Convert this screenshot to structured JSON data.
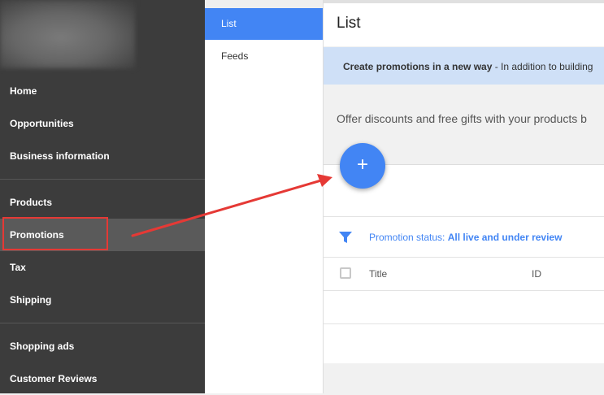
{
  "left_nav": {
    "items": [
      {
        "label": "Home"
      },
      {
        "label": "Opportunities"
      },
      {
        "label": "Business information"
      },
      {
        "label": "Products"
      },
      {
        "label": "Promotions"
      },
      {
        "label": "Tax"
      },
      {
        "label": "Shipping"
      },
      {
        "label": "Shopping ads"
      },
      {
        "label": "Customer Reviews"
      }
    ],
    "active": "Promotions"
  },
  "sub_nav": {
    "items": [
      {
        "label": "List"
      },
      {
        "label": "Feeds"
      }
    ],
    "active": "List"
  },
  "main": {
    "title": "List",
    "banner": {
      "bold": "Create promotions in a new way",
      "rest": " - In addition to building"
    },
    "offer_text": "Offer discounts and free gifts with your products b",
    "add_button_label": "+",
    "filter": {
      "label": "Promotion status: ",
      "value": "All live and under review"
    },
    "table": {
      "columns": [
        "Title",
        "ID"
      ]
    }
  },
  "colors": {
    "sidebar_bg": "#3c3c3c",
    "accent": "#4285f4",
    "banner_bg": "#cfe0f7",
    "annotation_red": "#e53935"
  },
  "icons": {
    "filter": "filter-icon",
    "add": "plus-icon",
    "annotation": "red-arrow-annotation"
  }
}
